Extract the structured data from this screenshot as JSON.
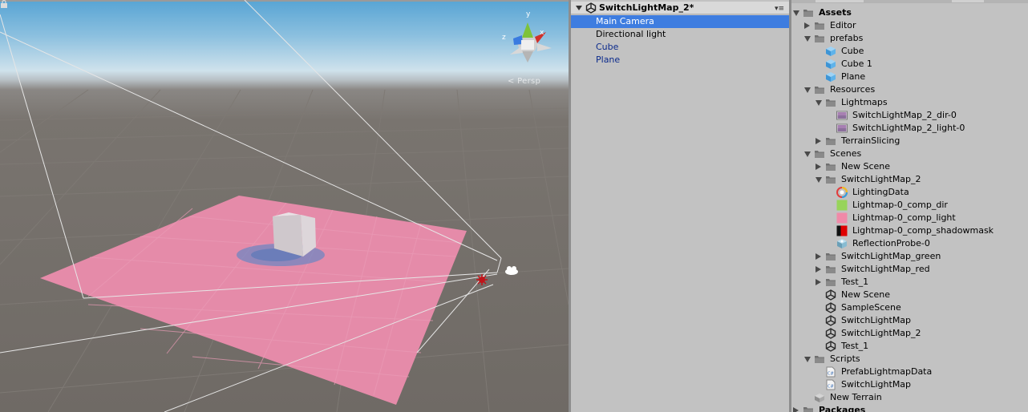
{
  "scene": {
    "persp_label": "< Persp",
    "gizmo": {
      "y": "y",
      "x": "x",
      "z": "z"
    },
    "colors": {
      "sky": "#57a4d4",
      "ground": "#6f6a65",
      "plane": "#e68aa8",
      "cube": "#d7d2d6"
    }
  },
  "hierarchy": {
    "scene_name": "SwitchLightMap_2*",
    "items": [
      {
        "label": "Main Camera",
        "selected": true,
        "prefab": false
      },
      {
        "label": "Directional light",
        "selected": false,
        "prefab": false
      },
      {
        "label": "Cube",
        "selected": false,
        "prefab": true
      },
      {
        "label": "Plane",
        "selected": false,
        "prefab": true
      }
    ]
  },
  "project": {
    "rows": [
      {
        "label": "Assets",
        "icon": "folder-icon",
        "expander": "open",
        "bold": true
      },
      {
        "label": "Editor",
        "icon": "folder-icon",
        "expander": "closed"
      },
      {
        "label": "prefabs",
        "icon": "folder-icon",
        "expander": "open"
      },
      {
        "label": "Cube",
        "icon": "prefab-icon"
      },
      {
        "label": "Cube 1",
        "icon": "prefab-icon"
      },
      {
        "label": "Plane",
        "icon": "prefab-icon"
      },
      {
        "label": "Resources",
        "icon": "folder-icon",
        "expander": "open"
      },
      {
        "label": "Lightmaps",
        "icon": "folder-icon",
        "expander": "open"
      },
      {
        "label": "SwitchLightMap_2_dir-0",
        "icon": "texture-icon"
      },
      {
        "label": "SwitchLightMap_2_light-0",
        "icon": "texture-icon"
      },
      {
        "label": "TerrainSlicing",
        "icon": "folder-icon",
        "expander": "closed"
      },
      {
        "label": "Scenes",
        "icon": "folder-icon",
        "expander": "open"
      },
      {
        "label": "New Scene",
        "icon": "folder-icon",
        "expander": "closed"
      },
      {
        "label": "SwitchLightMap_2",
        "icon": "folder-icon",
        "expander": "open"
      },
      {
        "label": "LightingData",
        "icon": "lighting-data-icon"
      },
      {
        "label": "Lightmap-0_comp_dir",
        "icon": "lightmap-dir-icon"
      },
      {
        "label": "Lightmap-0_comp_light",
        "icon": "lightmap-light-icon"
      },
      {
        "label": "Lightmap-0_comp_shadowmask",
        "icon": "shadowmask-icon"
      },
      {
        "label": "ReflectionProbe-0",
        "icon": "reflection-probe-icon"
      },
      {
        "label": "SwitchLightMap_green",
        "icon": "folder-icon",
        "expander": "closed"
      },
      {
        "label": "SwitchLightMap_red",
        "icon": "folder-icon",
        "expander": "closed"
      },
      {
        "label": "Test_1",
        "icon": "folder-icon",
        "expander": "closed"
      },
      {
        "label": "New Scene",
        "icon": "unity-scene-icon"
      },
      {
        "label": "SampleScene",
        "icon": "unity-scene-icon"
      },
      {
        "label": "SwitchLightMap",
        "icon": "unity-scene-icon"
      },
      {
        "label": "SwitchLightMap_2",
        "icon": "unity-scene-icon"
      },
      {
        "label": "Test_1",
        "icon": "unity-scene-icon"
      },
      {
        "label": "Scripts",
        "icon": "folder-icon",
        "expander": "open"
      },
      {
        "label": "PrefabLightmapData",
        "icon": "cs-script-icon"
      },
      {
        "label": "SwitchLightMap",
        "icon": "cs-script-icon"
      },
      {
        "label": "New Terrain",
        "icon": "terrain-icon"
      },
      {
        "label": "Packages",
        "icon": "folder-icon",
        "expander": "closed",
        "bold": true
      }
    ]
  }
}
